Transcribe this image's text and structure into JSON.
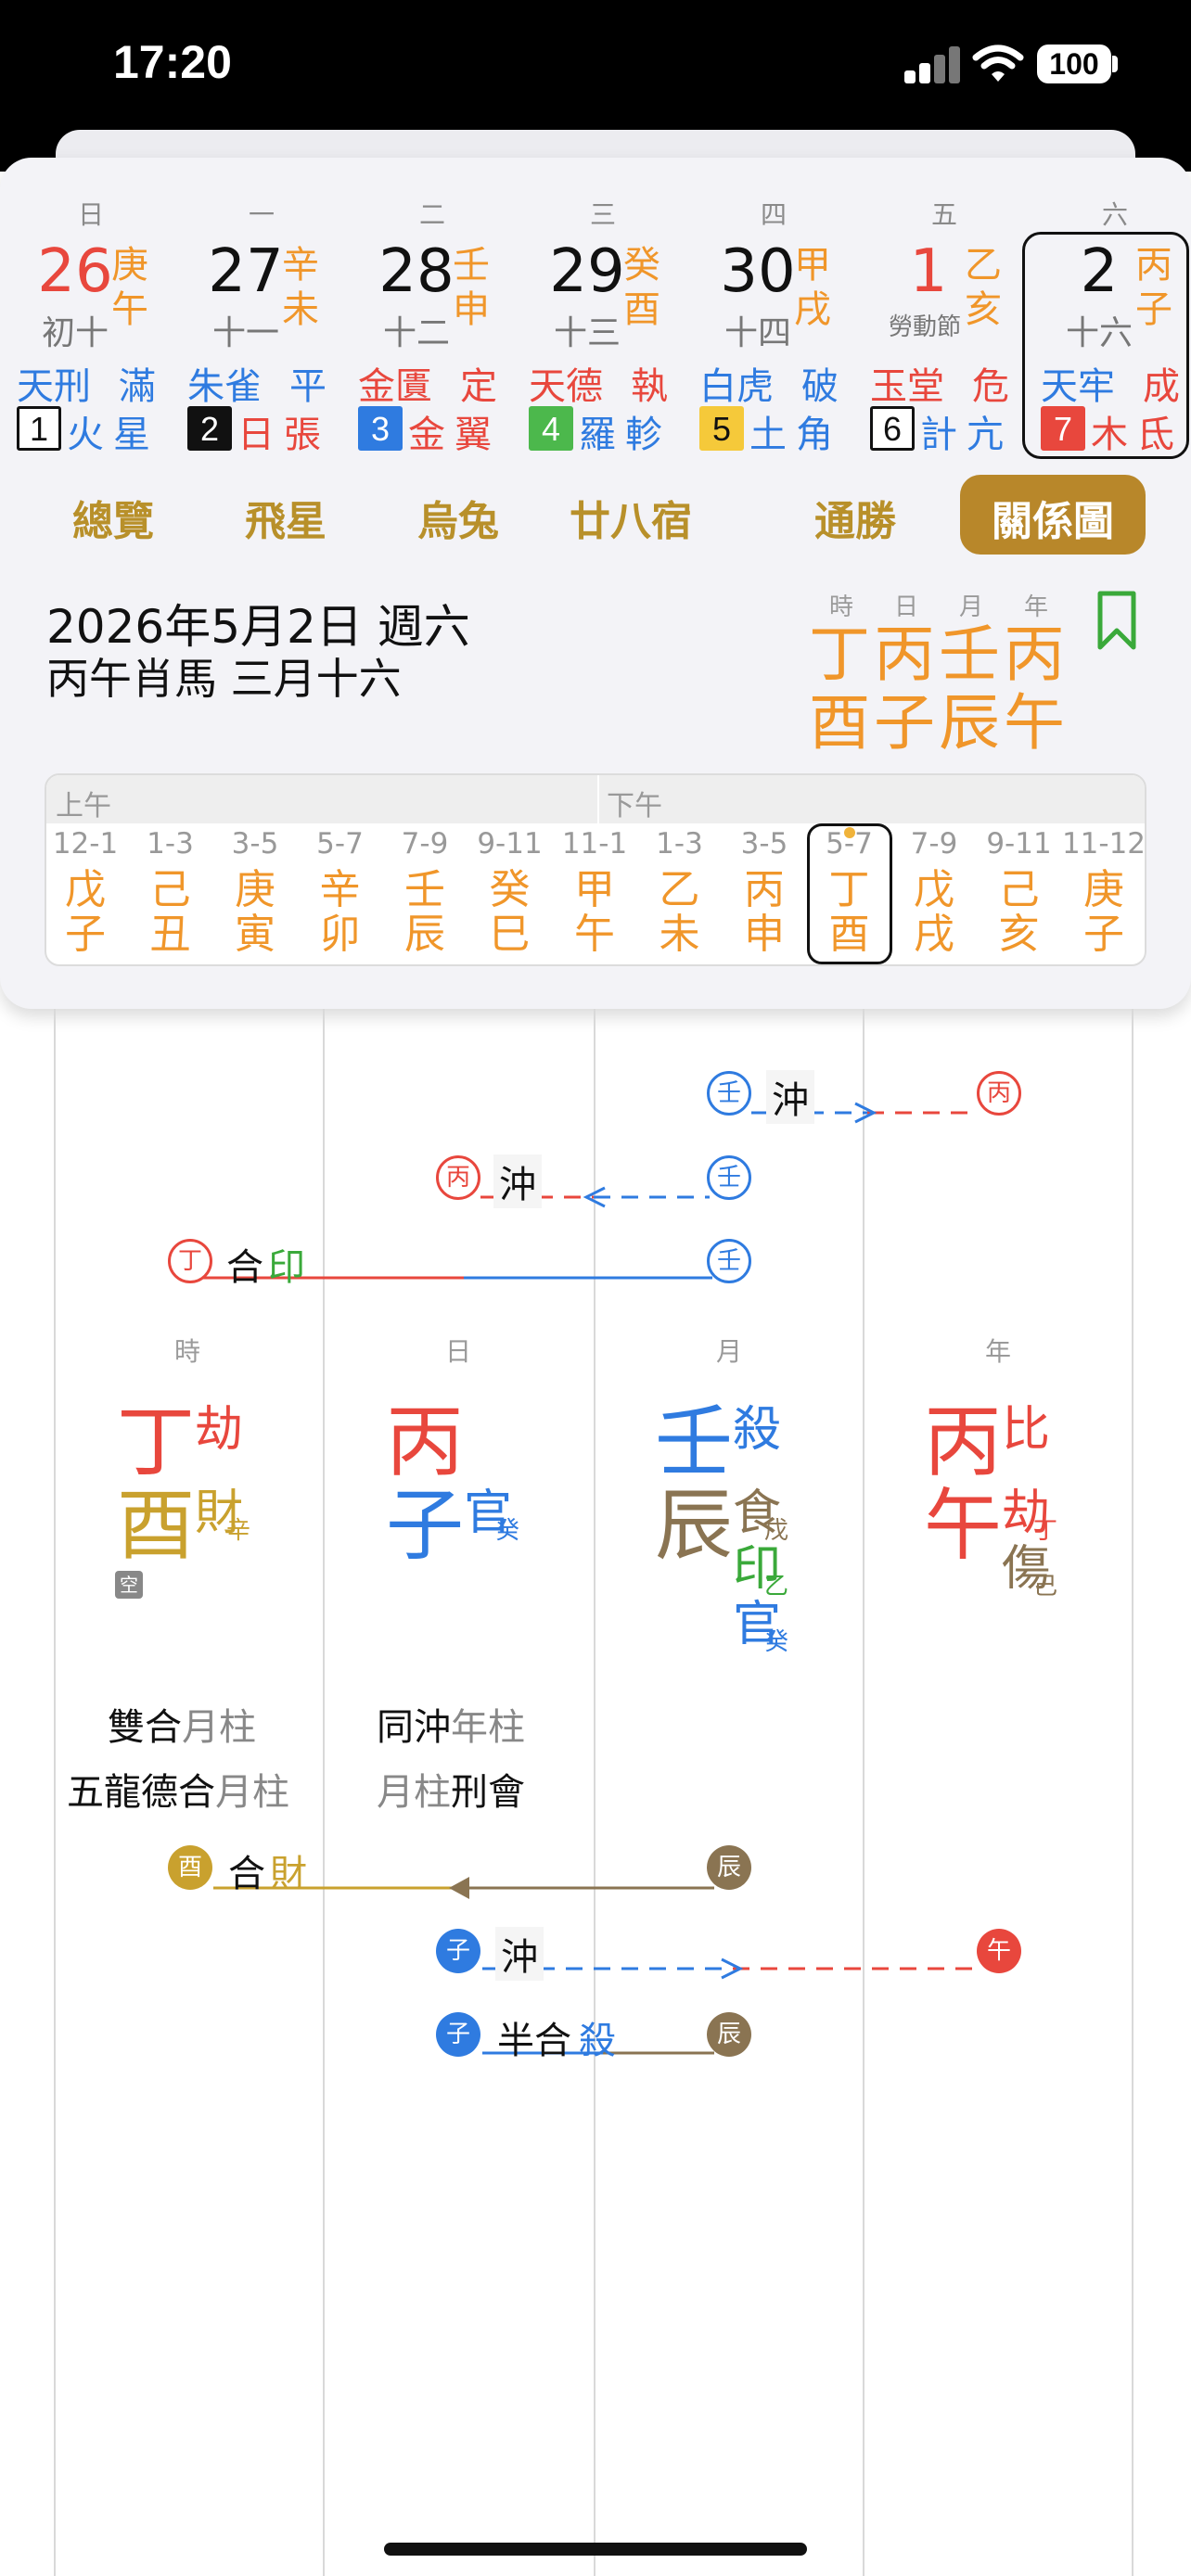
{
  "status": {
    "time": "17:20",
    "battery": "100"
  },
  "week": [
    {
      "wd": "日",
      "day": "26",
      "lunar": "初十",
      "g1": "庚",
      "g2": "午",
      "s1": "天刑",
      "s2": "滿",
      "num": "1",
      "planet": "火",
      "mansion": "星"
    },
    {
      "wd": "一",
      "day": "27",
      "lunar": "十一",
      "g1": "辛",
      "g2": "未",
      "s1": "朱雀",
      "s2": "平",
      "num": "2",
      "planet": "日",
      "mansion": "張"
    },
    {
      "wd": "二",
      "day": "28",
      "lunar": "十二",
      "g1": "壬",
      "g2": "申",
      "s1": "金匱",
      "s2": "定",
      "num": "3",
      "planet": "金",
      "mansion": "翼"
    },
    {
      "wd": "三",
      "day": "29",
      "lunar": "十三",
      "g1": "癸",
      "g2": "酉",
      "s1": "天德",
      "s2": "執",
      "num": "4",
      "planet": "羅",
      "mansion": "軫"
    },
    {
      "wd": "四",
      "day": "30",
      "lunar": "十四",
      "g1": "甲",
      "g2": "戌",
      "s1": "白虎",
      "s2": "破",
      "num": "5",
      "planet": "土",
      "mansion": "角"
    },
    {
      "wd": "五",
      "day": "1",
      "lunar": "勞動節",
      "g1": "乙",
      "g2": "亥",
      "s1": "玉堂",
      "s2": "危",
      "num": "6",
      "planet": "計",
      "mansion": "亢"
    },
    {
      "wd": "六",
      "day": "2",
      "lunar": "十六",
      "g1": "丙",
      "g2": "子",
      "s1": "天牢",
      "s2": "成",
      "num": "7",
      "planet": "木",
      "mansion": "氐"
    }
  ],
  "tabs": [
    "總覽",
    "飛星",
    "烏兔",
    "廿八宿",
    "通勝",
    "關係圖"
  ],
  "selected": {
    "date": "2026年5月2日 週六",
    "sub": "丙午肖馬 三月十六"
  },
  "pillar_heads": [
    "時",
    "日",
    "月",
    "年"
  ],
  "pillar_top": [
    "丁",
    "丙",
    "壬",
    "丙"
  ],
  "pillar_bottom": [
    "酉",
    "子",
    "辰",
    "午"
  ],
  "hours": {
    "am": "上午",
    "pm": "下午",
    "slots": [
      {
        "t": "12-1",
        "a": "戊",
        "b": "子"
      },
      {
        "t": "1-3",
        "a": "己",
        "b": "丑"
      },
      {
        "t": "3-5",
        "a": "庚",
        "b": "寅"
      },
      {
        "t": "5-7",
        "a": "辛",
        "b": "卯"
      },
      {
        "t": "7-9",
        "a": "壬",
        "b": "辰"
      },
      {
        "t": "9-11",
        "a": "癸",
        "b": "巳"
      },
      {
        "t": "11-1",
        "a": "甲",
        "b": "午"
      },
      {
        "t": "1-3",
        "a": "乙",
        "b": "未"
      },
      {
        "t": "3-5",
        "a": "丙",
        "b": "申"
      },
      {
        "t": "5-7",
        "a": "丁",
        "b": "酉"
      },
      {
        "t": "7-9",
        "a": "戊",
        "b": "戌"
      },
      {
        "t": "9-11",
        "a": "己",
        "b": "亥"
      },
      {
        "t": "11-12",
        "a": "庚",
        "b": "子"
      }
    ]
  },
  "relations_top": [
    {
      "from": "壬",
      "label": "沖",
      "to": "丙"
    },
    {
      "from": "丙",
      "label": "沖",
      "to": "壬"
    },
    {
      "from": "丁",
      "label_a": "合",
      "label_b": "印",
      "to": "壬"
    }
  ],
  "chart": {
    "heads": [
      "時",
      "日",
      "月",
      "年"
    ],
    "hour": {
      "stem": "丁",
      "branch": "酉",
      "god1": "劫",
      "god2": "財",
      "god2_sub": "辛",
      "kong": "空"
    },
    "day": {
      "stem": "丙",
      "branch": "子",
      "god2": "官",
      "god2_sub": "癸"
    },
    "month": {
      "stem": "壬",
      "branch": "辰",
      "god1": "殺",
      "h1": "食",
      "h1_sub": "戊",
      "h2": "印",
      "h2_sub": "乙",
      "h3": "官",
      "h3_sub": "癸"
    },
    "year": {
      "stem": "丙",
      "branch": "午",
      "god1": "比",
      "h1": "劫",
      "h1_sub": "丁",
      "h2": "傷",
      "h2_sub": "己"
    }
  },
  "descs": {
    "hour1_a": "雙合",
    "hour1_b": "月柱",
    "hour2_a": "五龍德合",
    "hour2_b": "月柱",
    "day1_a": "同沖",
    "day1_b": "年柱",
    "day2_a": "月柱",
    "day2_b": "刑會"
  },
  "relations_bottom": [
    {
      "from": "酉",
      "label_a": "合",
      "label_b": "財",
      "to": "辰"
    },
    {
      "from": "子",
      "label": "沖",
      "to": "午"
    },
    {
      "from": "子",
      "label_a": "半合",
      "label_b": "殺",
      "to": "辰"
    }
  ],
  "colors": {
    "orange": "#f0962a",
    "red": "#e8473d",
    "blue": "#2f7be0",
    "brown": "#8a7452",
    "gold": "#c9a12e",
    "green": "#3aa93a",
    "tabgold": "#b8902a"
  }
}
